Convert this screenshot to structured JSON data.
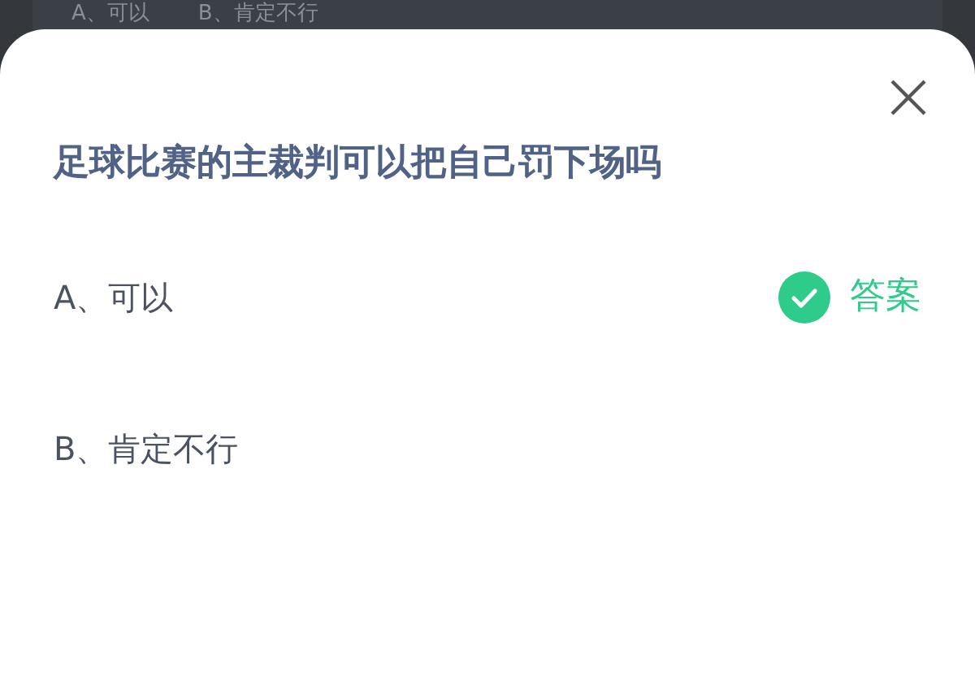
{
  "background_options": [
    "A、可以",
    "B、肯定不行"
  ],
  "question": "足球比赛的主裁判可以把自己罚下场吗",
  "answer_label": "答案",
  "options": [
    {
      "text": "A、可以",
      "correct": true
    },
    {
      "text": "B、肯定不行",
      "correct": false
    }
  ]
}
